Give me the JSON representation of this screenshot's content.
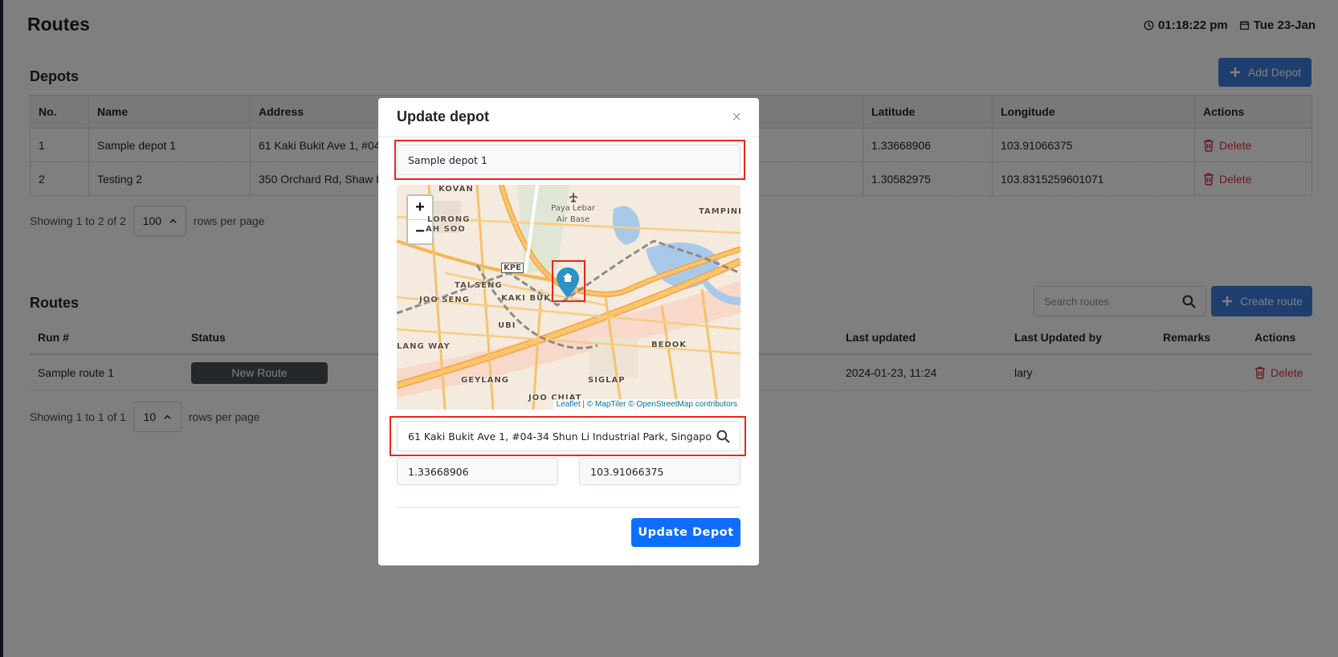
{
  "page": {
    "title": "Routes",
    "time": "01:18:22 pm",
    "date": "Tue 23-Jan"
  },
  "depots": {
    "title": "Depots",
    "add_label": "Add Depot",
    "columns": [
      "No.",
      "Name",
      "Address",
      "Latitude",
      "Longitude",
      "Actions"
    ],
    "rows": [
      {
        "no": "1",
        "name": "Sample depot 1",
        "address": "61 Kaki Bukit Ave 1, #04",
        "lat": "1.33668906",
        "lng": "103.91066375",
        "action": "Delete"
      },
      {
        "no": "2",
        "name": "Testing 2",
        "address": "350 Orchard Rd, Shaw H",
        "lat": "1.30582975",
        "lng": "103.8315259601071",
        "action": "Delete"
      }
    ],
    "showing": "Showing 1 to 2 of 2",
    "per_page": "100",
    "rows_per_page": "rows per page"
  },
  "routes": {
    "title": "Routes",
    "search_placeholder": "Search routes",
    "create_label": "Create route",
    "columns": [
      "Run #",
      "Status",
      "Last updated",
      "Last Updated by",
      "Remarks",
      "Actions"
    ],
    "rows": [
      {
        "run": "Sample route 1",
        "status": "New Route",
        "updated": "2024-01-23, 11:24",
        "updated_by": "lary",
        "remarks": "",
        "action": "Delete"
      }
    ],
    "showing": "Showing 1 to 1 of 1",
    "per_page": "10",
    "rows_per_page": "rows per page"
  },
  "modal": {
    "title": "Update depot",
    "close": "×",
    "name_value": "Sample depot 1",
    "address_value": "61 Kaki Bukit Ave 1, #04-34 Shun Li Industrial Park, Singapo",
    "latitude_value": "1.33668906",
    "longitude_value": "103.91066375",
    "submit_label": "Update Depot",
    "map": {
      "zoom_in": "+",
      "zoom_out": "−",
      "attribution_leaflet": "Leaflet",
      "attribution_rest": "| © MapTiler © OpenStreetMap contributors",
      "labels": {
        "kovan": "KOVAN",
        "paya": "Paya Lebar",
        "airbase": "Air Base",
        "tampines": "TAMPINE",
        "lorong": "LORONG",
        "ahsoo": "AH SOO",
        "kpe": "KPE",
        "taiseng": "TAI SENG",
        "jooseng": "JOO SENG",
        "kakibukit": "KAKI BUKI",
        "ubi": "UBI",
        "langway": "LANG WAY",
        "bedok": "BEDOK",
        "geylang": "GEYLANG",
        "siglap": "SIGLAP",
        "joochiat": "JOO CHIAT"
      }
    }
  },
  "colors": {
    "primary": "#3b7ddd",
    "modal_button": "#0d6efd",
    "danger": "#dc3545",
    "highlight": "#e8271c",
    "marker": "#2a93c9"
  }
}
